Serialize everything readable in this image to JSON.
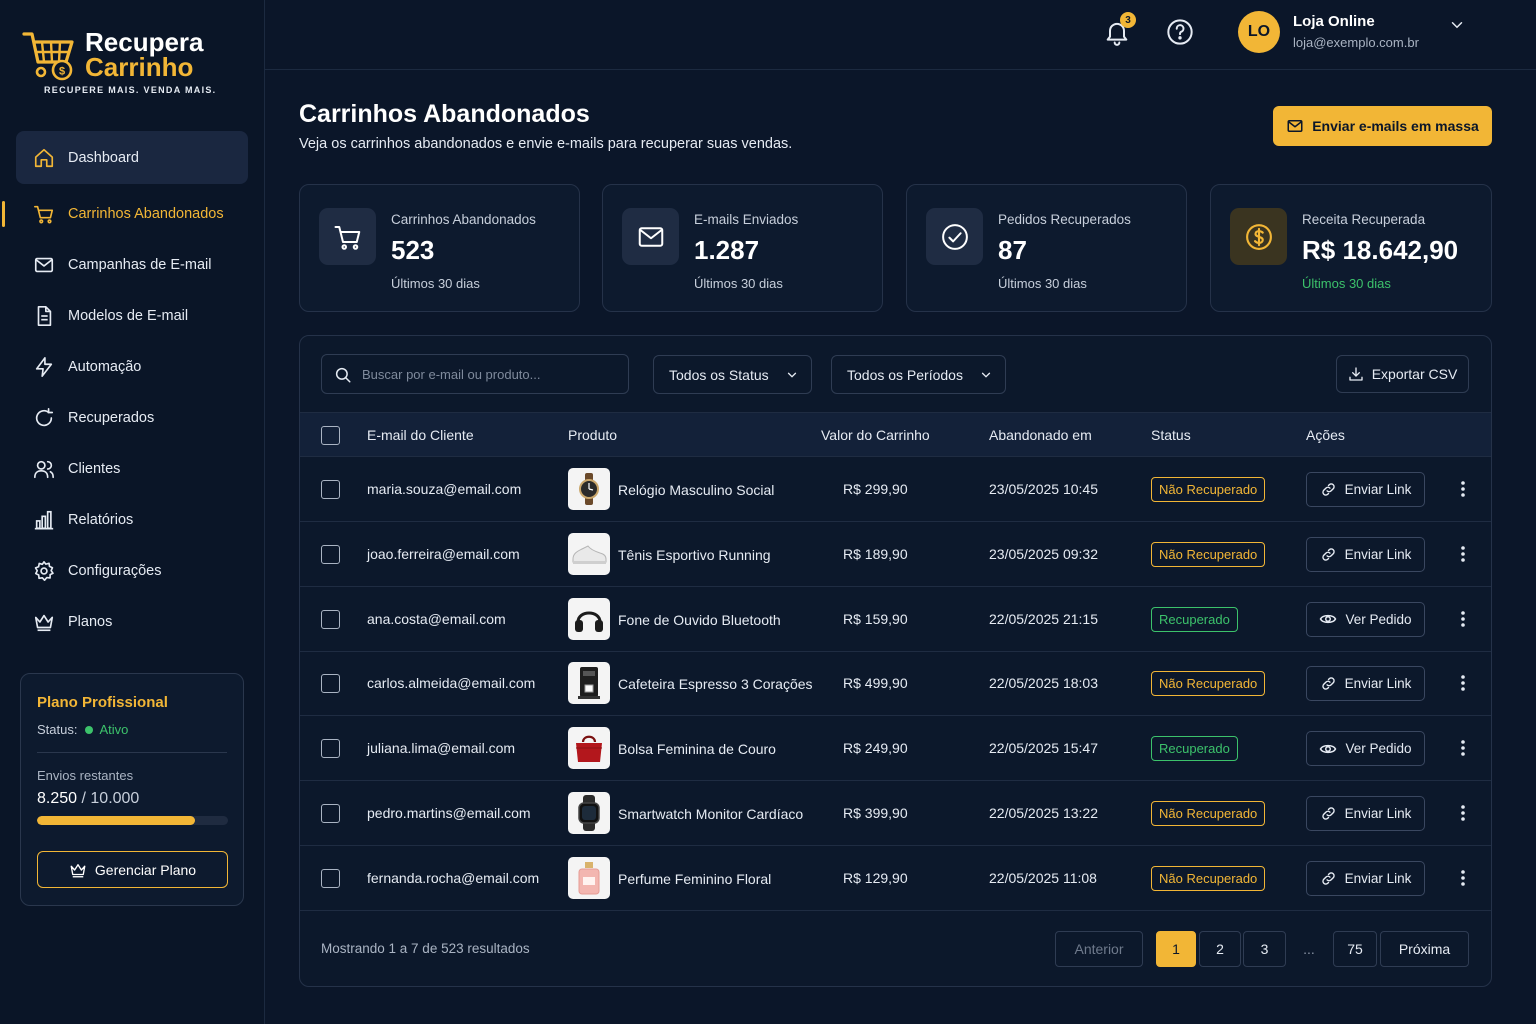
{
  "brand": {
    "line1": "Recupera",
    "line2": "Carrinho",
    "tagline": "RECUPERE MAIS. VENDA MAIS."
  },
  "colors": {
    "accent": "#f2b636",
    "background": "#0b1629",
    "success": "#3cc26b"
  },
  "sidebar": {
    "items": [
      {
        "label": "Dashboard",
        "icon": "home-icon"
      },
      {
        "label": "Carrinhos Abandonados",
        "icon": "cart-icon"
      },
      {
        "label": "Campanhas de E-mail",
        "icon": "mail-icon"
      },
      {
        "label": "Modelos de E-mail",
        "icon": "document-icon"
      },
      {
        "label": "Automação",
        "icon": "bolt-icon"
      },
      {
        "label": "Recuperados",
        "icon": "refresh-icon"
      },
      {
        "label": "Clientes",
        "icon": "users-icon"
      },
      {
        "label": "Relatórios",
        "icon": "bar-chart-icon"
      },
      {
        "label": "Configurações",
        "icon": "gear-icon"
      },
      {
        "label": "Planos",
        "icon": "crown-icon"
      }
    ],
    "active_index": 1
  },
  "plan": {
    "title": "Plano Profissional",
    "status_label": "Status:",
    "status_value": "Ativo",
    "sends_label": "Envios restantes",
    "sends_used": "8.250",
    "sends_total": "/ 10.000",
    "sends_fraction": 0.825,
    "manage_label": "Gerenciar Plano"
  },
  "topbar": {
    "notifications_count": "3",
    "avatar_initials": "LO",
    "user_name": "Loja Online",
    "user_email": "loja@exemplo.com.br"
  },
  "header": {
    "title": "Carrinhos Abandonados",
    "subtitle": "Veja os carrinhos abandonados e envie e-mails para recuperar suas vendas.",
    "mass_email_label": "Enviar e-mails em massa"
  },
  "stats": [
    {
      "label": "Carrinhos Abandonados",
      "value": "523",
      "period": "Últimos 30 dias",
      "icon": "cart-icon"
    },
    {
      "label": "E-mails Enviados",
      "value": "1.287",
      "period": "Últimos 30 dias",
      "icon": "mail-icon"
    },
    {
      "label": "Pedidos Recuperados",
      "value": "87",
      "period": "Últimos 30 dias",
      "icon": "check-circle-icon"
    },
    {
      "label": "Receita Recuperada",
      "value": "R$ 18.642,90",
      "period": "Últimos 30 dias",
      "icon": "dollar-coin-icon"
    }
  ],
  "filters": {
    "search_placeholder": "Buscar por e-mail ou produto...",
    "status_select": "Todos os Status",
    "period_select": "Todos os Períodos",
    "export_label": "Exportar CSV"
  },
  "table": {
    "columns": [
      "E-mail do Cliente",
      "Produto",
      "Valor do Carrinho",
      "Abandonado em",
      "Status",
      "Ações"
    ],
    "rows": [
      {
        "email": "maria.souza@email.com",
        "product": "Relógio Masculino Social",
        "thumb": "watch-thumb",
        "value": "R$ 299,90",
        "date": "23/05/2025 10:45",
        "status": "Não Recuperado",
        "recovered": false,
        "action": "Enviar Link"
      },
      {
        "email": "joao.ferreira@email.com",
        "product": "Tênis Esportivo Running",
        "thumb": "sneaker-thumb",
        "value": "R$ 189,90",
        "date": "23/05/2025 09:32",
        "status": "Não Recuperado",
        "recovered": false,
        "action": "Enviar Link"
      },
      {
        "email": "ana.costa@email.com",
        "product": "Fone de Ouvido Bluetooth",
        "thumb": "headphones-thumb",
        "value": "R$ 159,90",
        "date": "22/05/2025 21:15",
        "status": "Recuperado",
        "recovered": true,
        "action": "Ver Pedido"
      },
      {
        "email": "carlos.almeida@email.com",
        "product": "Cafeteira Espresso 3 Corações",
        "thumb": "coffee-maker-thumb",
        "value": "R$ 499,90",
        "date": "22/05/2025 18:03",
        "status": "Não Recuperado",
        "recovered": false,
        "action": "Enviar Link"
      },
      {
        "email": "juliana.lima@email.com",
        "product": "Bolsa Feminina de Couro",
        "thumb": "handbag-thumb",
        "value": "R$ 249,90",
        "date": "22/05/2025 15:47",
        "status": "Recuperado",
        "recovered": true,
        "action": "Ver Pedido"
      },
      {
        "email": "pedro.martins@email.com",
        "product": "Smartwatch Monitor Cardíaco",
        "thumb": "smartwatch-thumb",
        "value": "R$ 399,90",
        "date": "22/05/2025 13:22",
        "status": "Não Recuperado",
        "recovered": false,
        "action": "Enviar Link"
      },
      {
        "email": "fernanda.rocha@email.com",
        "product": "Perfume Feminino Floral",
        "thumb": "perfume-thumb",
        "value": "R$ 129,90",
        "date": "22/05/2025 11:08",
        "status": "Não Recuperado",
        "recovered": false,
        "action": "Enviar Link"
      }
    ]
  },
  "pagination": {
    "summary": "Mostrando 1 a 7 de 523 resultados",
    "prev": "Anterior",
    "pages": [
      "1",
      "2",
      "3"
    ],
    "ellipsis": "...",
    "last": "75",
    "next": "Próxima",
    "current": "1"
  }
}
